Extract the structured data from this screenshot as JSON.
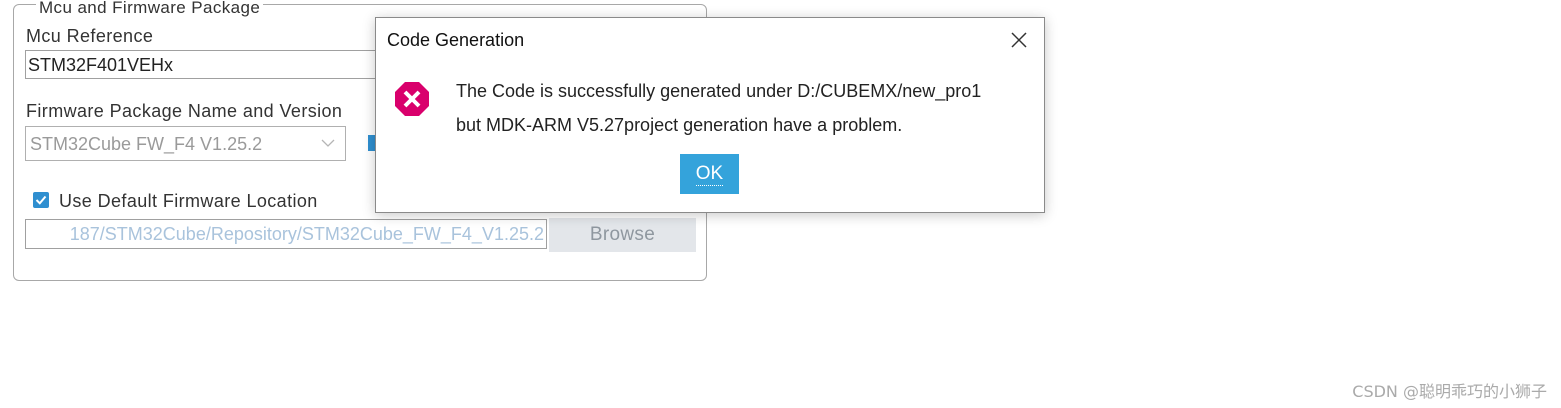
{
  "panel": {
    "group_title": "Mcu and Firmware Package",
    "mcu_reference_label": "Mcu Reference",
    "mcu_reference_value": "STM32F401VEHx",
    "firmware_label": "Firmware Package Name and Version",
    "firmware_value": "STM32Cube FW_F4 V1.25.2",
    "use_default_label": "Use Default Firmware Location",
    "use_default_checked": true,
    "firmware_path": "187/STM32Cube/Repository/STM32Cube_FW_F4_V1.25.2",
    "browse_label": "Browse"
  },
  "dialog": {
    "title": "Code Generation",
    "message_line1": "The Code is successfully generated under D:/CUBEMX/new_pro1",
    "message_line2": "but MDK-ARM V5.27project generation have a problem.",
    "ok_label": "OK",
    "icon": "error-icon",
    "icon_color": "#d9006c",
    "ok_color": "#34a3db"
  },
  "watermark": "CSDN @聪明乖巧的小狮子"
}
